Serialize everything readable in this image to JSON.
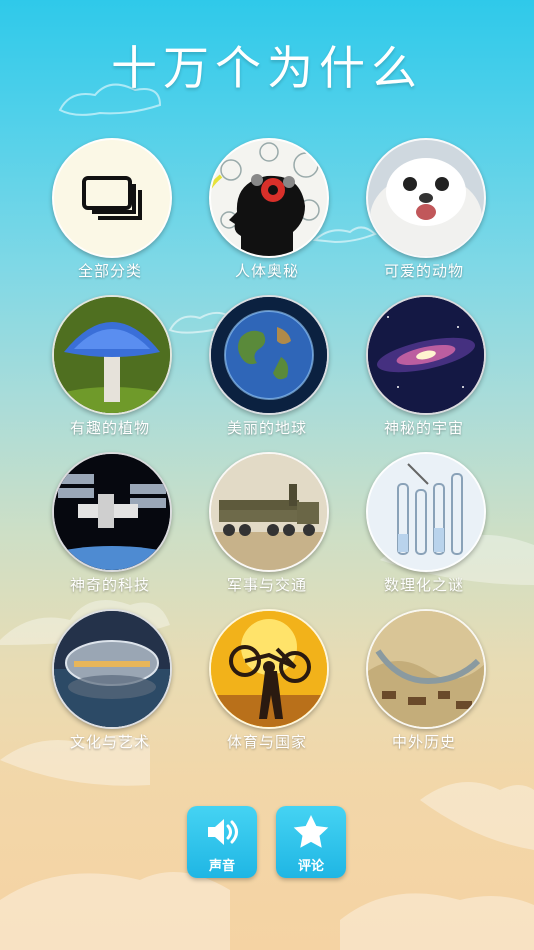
{
  "app": {
    "title": "十万个为什么"
  },
  "categories": [
    {
      "label": "全部分类",
      "icon": "all-categories-icon"
    },
    {
      "label": "人体奥秘",
      "icon": "human-head-gears-icon"
    },
    {
      "label": "可爱的动物",
      "icon": "seal-pup-icon"
    },
    {
      "label": "有趣的植物",
      "icon": "blue-mushroom-icon"
    },
    {
      "label": "美丽的地球",
      "icon": "earth-icon"
    },
    {
      "label": "神秘的宇宙",
      "icon": "galaxy-icon"
    },
    {
      "label": "神奇的科技",
      "icon": "space-station-icon"
    },
    {
      "label": "军事与交通",
      "icon": "missile-truck-icon"
    },
    {
      "label": "数理化之谜",
      "icon": "test-tubes-icon"
    },
    {
      "label": "文化与艺术",
      "icon": "opera-house-icon"
    },
    {
      "label": "体育与国家",
      "icon": "cyclist-sunset-icon"
    },
    {
      "label": "中外历史",
      "icon": "ancient-painting-icon"
    }
  ],
  "toolbar": {
    "sound_label": "声音",
    "review_label": "评论"
  },
  "colors": {
    "sky_top": "#2fc9ea",
    "sand_bottom": "#f5d3a3",
    "button": "#1fb6e4",
    "text": "#ffffff"
  }
}
